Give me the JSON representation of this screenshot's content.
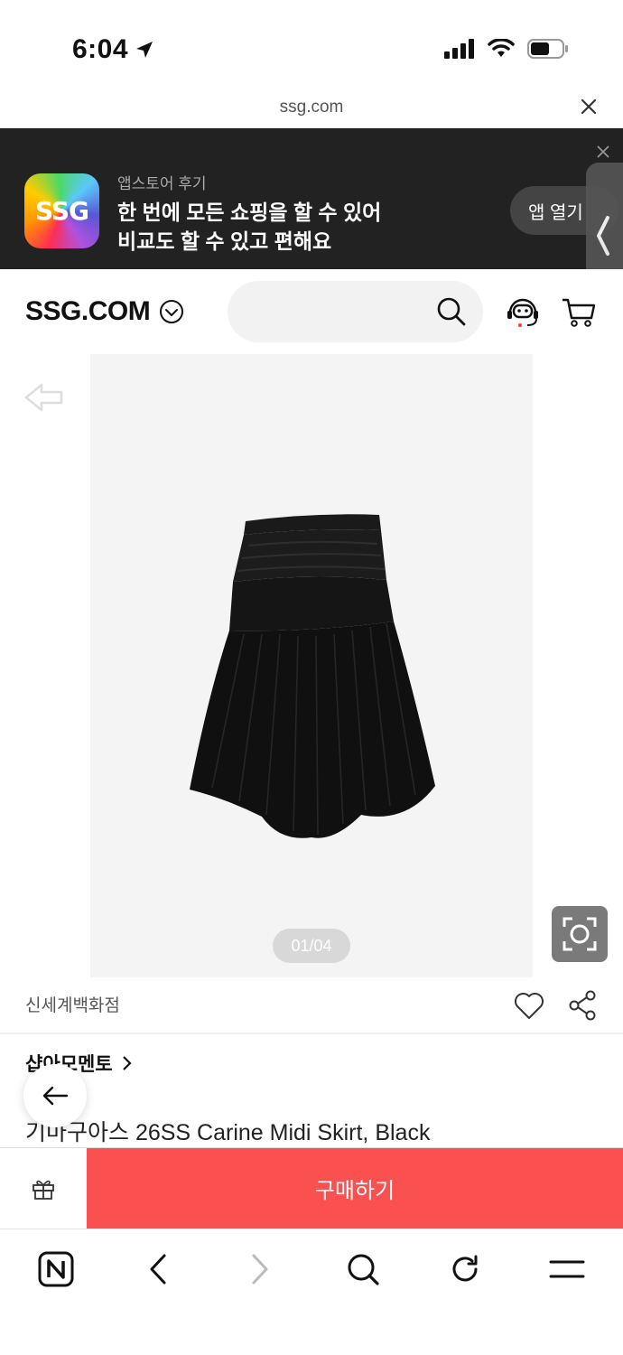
{
  "status": {
    "time": "6:04"
  },
  "url_bar": {
    "domain": "ssg.com"
  },
  "app_banner": {
    "logo_text": "SSG",
    "subtitle": "앱스토어 후기",
    "line1": "한 번에 모든 쇼핑을 할 수 있어",
    "line2": "비교도 할 수 있고 편해요",
    "open_label": "앱 열기"
  },
  "header": {
    "brand": "SSG.COM",
    "search_placeholder": ""
  },
  "product": {
    "image_counter": "01/04",
    "store": "신세계백화점",
    "brand_link": "샵아모멘토",
    "title": "기마구아스 26SS Carine Midi Skirt, Black"
  },
  "purchase": {
    "buy_label": "구매하기"
  },
  "colors": {
    "buy": "#fa5050",
    "banner_bg": "#222222"
  }
}
